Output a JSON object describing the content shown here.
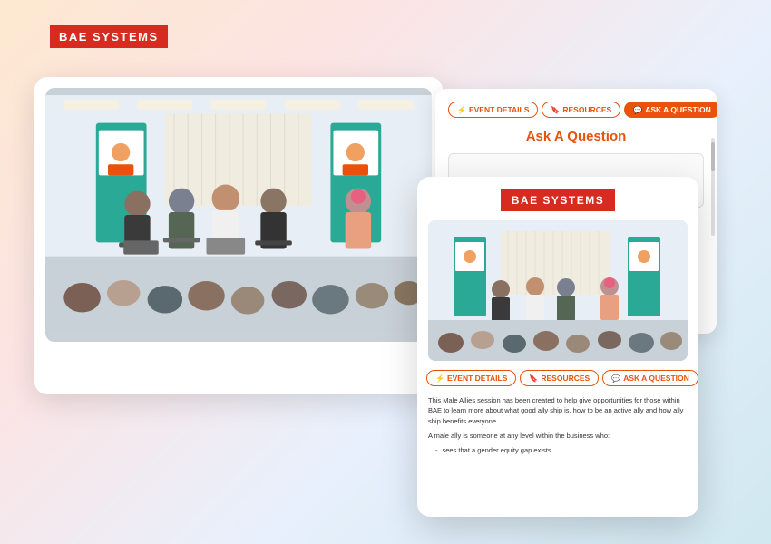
{
  "background": {
    "gradient_description": "warm peach to light blue gradient"
  },
  "logo": {
    "text": "BAE SYSTEMS",
    "color": "#d62b1e"
  },
  "card_back": {
    "type": "video_card",
    "description": "Panel discussion video — multiple speakers seated, audience in foreground"
  },
  "card_mid": {
    "type": "ask_question_card",
    "tabs": [
      {
        "label": "EVENT DETAILS",
        "icon": "lightning-icon",
        "active": false
      },
      {
        "label": "RESOURCES",
        "icon": "bookmark-icon",
        "active": false
      },
      {
        "label": "ASK A QUESTION",
        "icon": "chat-icon",
        "active": true
      }
    ],
    "title": "Ask A Question",
    "input_placeholder": ""
  },
  "card_front": {
    "type": "event_detail_card",
    "logo_text": "BAE SYSTEMS",
    "logo_color": "#d62b1e",
    "tabs": [
      {
        "label": "EVENT DETAILS",
        "icon": "lightning-icon",
        "active": false
      },
      {
        "label": "RESOURCES",
        "icon": "bookmark-icon",
        "active": false
      },
      {
        "label": "ASK A QUESTION",
        "icon": "chat-icon",
        "active": false
      }
    ],
    "description_line1": "This Male Allies session has been created to help give opportunities for those within BAE to learn more about what good ally ship is, how to be an active ally and how ally ship benefits everyone.",
    "description_line2": "A male ally is someone at any level within the business who:",
    "bullet_title": "",
    "bullets": [
      "sees that a gender equity gap exists"
    ]
  }
}
